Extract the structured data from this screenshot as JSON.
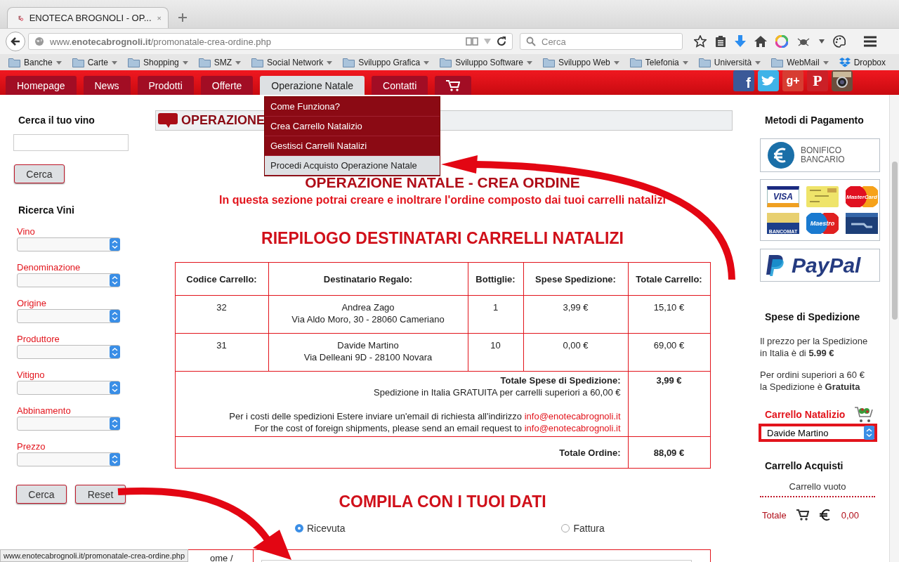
{
  "browser": {
    "tab_title": "ENOTECA BROGNOLI - OP...",
    "url": "www.**enotecabrognoli.it**/promonatale-crea-ordine.php",
    "search_placeholder": "Cerca",
    "bookmarks": [
      {
        "kind": "folder",
        "label": "Banche"
      },
      {
        "kind": "folder",
        "label": "Carte"
      },
      {
        "kind": "folder",
        "label": "Shopping"
      },
      {
        "kind": "folder",
        "label": "SMZ"
      },
      {
        "kind": "folder",
        "label": "Social Network"
      },
      {
        "kind": "folder",
        "label": "Sviluppo Grafica"
      },
      {
        "kind": "folder",
        "label": "Sviluppo Software"
      },
      {
        "kind": "folder",
        "label": "Sviluppo Web"
      },
      {
        "kind": "folder",
        "label": "Telefonia"
      },
      {
        "kind": "folder",
        "label": "Università"
      },
      {
        "kind": "folder",
        "label": "WebMail"
      },
      {
        "kind": "dropbox",
        "label": "Dropbox"
      }
    ],
    "status_url": "www.enotecabrognoli.it/promonatale-crea-ordine.php"
  },
  "nav": {
    "tabs": [
      {
        "kind": "text",
        "label": "Homepage",
        "selected": false
      },
      {
        "kind": "text",
        "label": "News",
        "selected": false
      },
      {
        "kind": "text",
        "label": "Prodotti",
        "selected": false
      },
      {
        "kind": "text",
        "label": "Offerte",
        "selected": false
      },
      {
        "kind": "text",
        "label": "Operazione Natale",
        "selected": true
      },
      {
        "kind": "text",
        "label": "Contatti",
        "selected": false
      },
      {
        "kind": "cart",
        "selected": false
      }
    ],
    "dropdown": [
      {
        "label": "Come Funziona?",
        "selected": false
      },
      {
        "label": "Crea Carrello Natalizio",
        "selected": false
      },
      {
        "label": "Gestisci Carrelli Natalizi",
        "selected": false
      },
      {
        "label": "Procedi Acquisto Operazione Natale",
        "selected": true
      }
    ],
    "social": [
      {
        "kind": "facebook",
        "label": "f"
      },
      {
        "kind": "twitter"
      },
      {
        "kind": "googleplus",
        "label": "g+"
      },
      {
        "kind": "pinterest",
        "label": "P"
      },
      {
        "kind": "instagram"
      }
    ]
  },
  "left": {
    "search_title": "Cerca il tuo vino",
    "search_button": "Cerca",
    "filters_title": "Ricerca Vini",
    "filters": [
      {
        "label": "Vino"
      },
      {
        "label": "Denominazione"
      },
      {
        "label": "Origine"
      },
      {
        "label": "Produttore"
      },
      {
        "label": "Vitigno"
      },
      {
        "label": "Abbinamento"
      },
      {
        "label": "Prezzo"
      }
    ],
    "buttons": [
      "Cerca",
      "Reset"
    ]
  },
  "main": {
    "banner": "OPERAZIONE",
    "heading": "OPERAZIONE NATALE - CREA ORDINE",
    "subtitle": "In questa sezione potrai creare e inoltrare l'ordine composto dai tuoi carrelli natalizi",
    "summary_title": "RIEPILOGO DESTINATARI CARRELLI NATALIZI",
    "table": {
      "columns": [
        "Codice Carrello:",
        "Destinatario Regalo:",
        "Bottiglie:",
        "Spese Spedizione:",
        "Totale Carrello:"
      ],
      "rows": [
        {
          "code": "32",
          "name": "Andrea Zago",
          "address": "Via Aldo Moro, 30 - 28060 Cameriano",
          "bottles": "1",
          "shipping": "3,99 €",
          "total": "15,10 €"
        },
        {
          "code": "31",
          "name": "Davide Martino",
          "address": "Via Delleani 9D - 28100 Novara",
          "bottles": "10",
          "shipping": "0,00 €",
          "total": "69,00 €"
        }
      ],
      "shipping_label": "Totale Spese di Spedizione:",
      "shipping_total": "3,99 €",
      "free_note": "Spedizione in Italia GRATUITA per carrelli superiori a 60,00 €",
      "foreign": [
        {
          "text": "Per i costi delle spedizioni Estere inviare un'email di richiesta all'indirizzo",
          "email": "info@enotecabrognoli.it"
        },
        {
          "text": "For the cost of foreign shipments, please send an email request to",
          "email": "info@enotecabrognoli.it"
        }
      ],
      "order_label": "Totale Ordine:",
      "order_total": "88,09 €"
    },
    "form_title": "COMPILA CON I TUOI DATI",
    "doc_type": [
      {
        "label": "Ricevuta",
        "selected": true
      },
      {
        "label": "Fattura",
        "selected": false
      }
    ],
    "form_label": "ome /"
  },
  "right": {
    "payment_title": "Metodi di Pagamento",
    "bank": [
      "BONIFICO",
      "BANCARIO"
    ],
    "cards": [
      {
        "kind": "visa",
        "label": "VISA"
      },
      {
        "kind": "postepay"
      },
      {
        "kind": "mastercard",
        "label": "MasterCard"
      },
      {
        "kind": "pagobancomat",
        "label": "BANCOMAT"
      },
      {
        "kind": "maestro",
        "label": "Maestro"
      },
      {
        "kind": "bancoposta"
      }
    ],
    "paypal": "PayPal",
    "shipping_title": "Spese di Spedizione",
    "shipping_notes": [
      "Il prezzo per la Spedizione in Italia è di **5.99 €**",
      "Per ordini superiori a 60 € la Spedizione è **Gratuita**"
    ],
    "xmas_title": "Carrello Natalizio",
    "xmas_value": "Davide Martino",
    "cart_title": "Carrello Acquisti",
    "cart_empty": "Carrello vuoto",
    "total_label": "Totale",
    "total_value": "0,00"
  }
}
